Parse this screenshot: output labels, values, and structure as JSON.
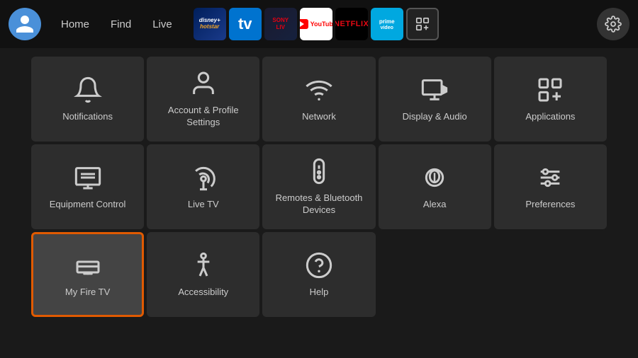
{
  "nav": {
    "links": [
      "Home",
      "Find",
      "Live"
    ],
    "apps": [
      {
        "name": "Disney+ Hotstar",
        "class": "app-disney",
        "label": "disney+\nhotstar"
      },
      {
        "name": "TV+",
        "class": "app-tvplus",
        "label": "tv"
      },
      {
        "name": "Sony LIV",
        "class": "app-sony",
        "label": "SONY\nLIV"
      },
      {
        "name": "YouTube",
        "class": "app-youtube",
        "label": "YouTube"
      },
      {
        "name": "Netflix",
        "class": "app-netflix",
        "label": "NETFLIX"
      },
      {
        "name": "Prime Video",
        "class": "app-prime",
        "label": "prime\nvideo"
      },
      {
        "name": "App Grid",
        "class": "app-grid",
        "label": "⊞"
      }
    ]
  },
  "grid": {
    "items": [
      {
        "id": "notifications",
        "label": "Notifications",
        "icon": "bell",
        "selected": false
      },
      {
        "id": "account",
        "label": "Account & Profile Settings",
        "icon": "person",
        "selected": false
      },
      {
        "id": "network",
        "label": "Network",
        "icon": "wifi",
        "selected": false
      },
      {
        "id": "display-audio",
        "label": "Display & Audio",
        "icon": "display-audio",
        "selected": false
      },
      {
        "id": "applications",
        "label": "Applications",
        "icon": "apps",
        "selected": false
      },
      {
        "id": "equipment",
        "label": "Equipment Control",
        "icon": "monitor",
        "selected": false
      },
      {
        "id": "livetv",
        "label": "Live TV",
        "icon": "antenna",
        "selected": false
      },
      {
        "id": "remotes",
        "label": "Remotes & Bluetooth Devices",
        "icon": "remote",
        "selected": false
      },
      {
        "id": "alexa",
        "label": "Alexa",
        "icon": "alexa",
        "selected": false
      },
      {
        "id": "preferences",
        "label": "Preferences",
        "icon": "sliders",
        "selected": false
      },
      {
        "id": "myfiretv",
        "label": "My Fire TV",
        "icon": "firetv",
        "selected": true
      },
      {
        "id": "accessibility",
        "label": "Accessibility",
        "icon": "accessibility",
        "selected": false
      },
      {
        "id": "help",
        "label": "Help",
        "icon": "help",
        "selected": false
      }
    ]
  },
  "settings_icon": "⚙"
}
